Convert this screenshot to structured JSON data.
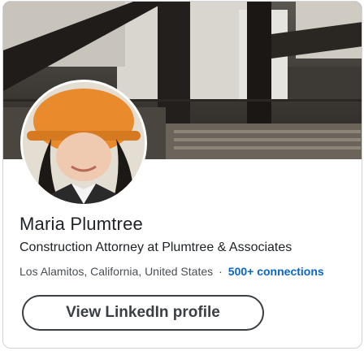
{
  "profile": {
    "name": "Maria Plumtree",
    "headline": "Construction Attorney at Plumtree & Associates",
    "location": "Los Alamitos, California, United States",
    "separator": "·",
    "connections": "500+ connections"
  },
  "actions": {
    "view_profile_label": "View LinkedIn profile"
  },
  "colors": {
    "link_blue": "#0a66c2",
    "text_dark": "#1d2226",
    "border": "#d0d4d8"
  }
}
